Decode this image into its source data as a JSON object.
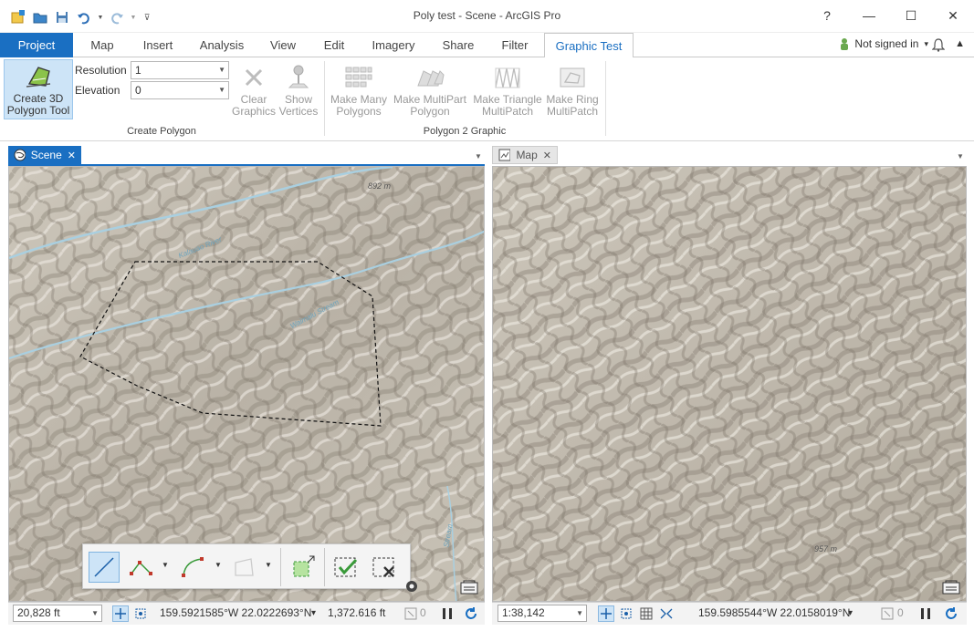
{
  "window": {
    "title": "Poly test - Scene - ArcGIS Pro",
    "help": "?",
    "minimize": "—",
    "maximize": "☐",
    "close": "✕"
  },
  "ribbon_tabs": [
    {
      "label": "Project"
    },
    {
      "label": "Map"
    },
    {
      "label": "Insert"
    },
    {
      "label": "Analysis"
    },
    {
      "label": "View"
    },
    {
      "label": "Edit"
    },
    {
      "label": "Imagery"
    },
    {
      "label": "Share"
    },
    {
      "label": "Filter"
    },
    {
      "label": "Graphic Test"
    }
  ],
  "account": {
    "label": "Not signed in",
    "caret": "▾"
  },
  "ribbon": {
    "create_3d_line1": "Create 3D",
    "create_3d_line2": "Polygon Tool",
    "resolution_label": "Resolution",
    "resolution_value": "1",
    "elevation_label": "Elevation",
    "elevation_value": "0",
    "clear_line1": "Clear",
    "clear_line2": "Graphics",
    "show_line1": "Show",
    "show_line2": "Vertices",
    "group1_label": "Create Polygon",
    "many_line1": "Make Many",
    "many_line2": "Polygons",
    "multipart_line1": "Make MultiPart",
    "multipart_line2": "Polygon",
    "triangle_line1": "Make Triangle",
    "triangle_line2": "MultiPatch",
    "ring_line1": "Make Ring",
    "ring_line2": "MultiPatch",
    "group2_label": "Polygon 2 Graphic"
  },
  "panes": {
    "scene_tab": "Scene",
    "map_tab": "Map",
    "close_glyph": "✕"
  },
  "scene_labels": {
    "elev1": "892 m",
    "river1": "Kalauao River",
    "river2": "Waimalu Stream",
    "river3": "Stream"
  },
  "map_labels": {
    "elev2": "957 m"
  },
  "scene_status": {
    "scale": "20,828 ft",
    "coords": "159.5921585°W 22.0222693°N",
    "coord_caret": "▾",
    "elevation": "1,372.616 ft",
    "count": "0"
  },
  "map_status": {
    "scale": "1:38,142",
    "coords": "159.5985544°W 22.0158019°N",
    "coord_caret": "▾",
    "count": "0"
  },
  "colors": {
    "accent": "#1a6fc2",
    "terrain_light": "#d8d3c8",
    "terrain_dark": "#8f877b",
    "river": "#a9cfe0",
    "confirm_green": "#3a9a3a"
  }
}
